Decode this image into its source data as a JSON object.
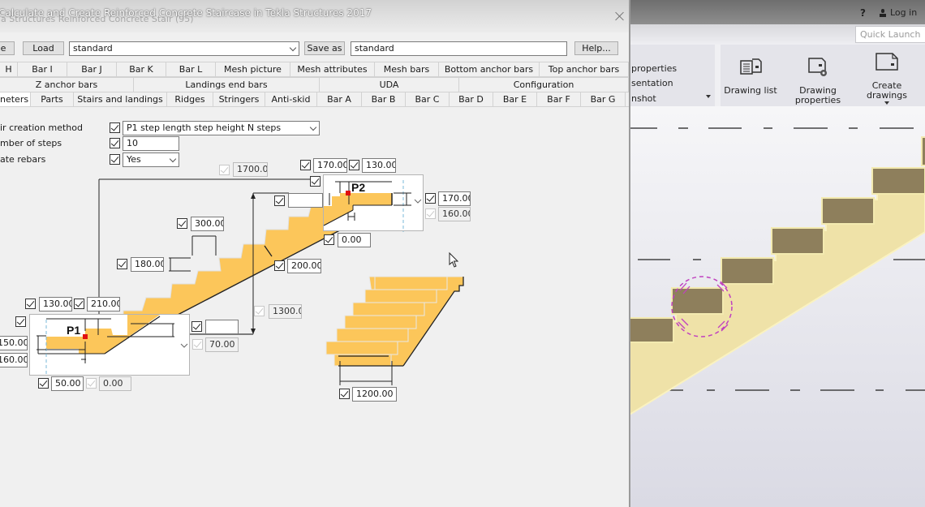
{
  "background_app": {
    "help_label": "?",
    "login_label": "Log in",
    "quick_launch_placeholder": "Quick Launch",
    "ribbon_left_items": [
      "properties",
      "sentation",
      "nshot"
    ],
    "ribbon_buttons": [
      {
        "label": "Drawing list",
        "icon": "drawing-list-icon"
      },
      {
        "label": "Drawing properties",
        "icon": "drawing-properties-icon"
      },
      {
        "label": "Create drawings",
        "icon": "create-drawings-icon"
      }
    ]
  },
  "dialog": {
    "title": "Calculate and Create Reinforced Concrete Staircase in Tekla Structures 2017",
    "title_ghost": "la Structures  Reinforced Concrete Stair (95)",
    "toolbar": {
      "save_label": "e",
      "load_label": "Load",
      "preset_value": "standard",
      "save_as_label": "Save as",
      "save_as_value": "standard",
      "help_label": "Help..."
    },
    "tab_rows": [
      [
        "H",
        "Bar I",
        "Bar J",
        "Bar K",
        "Bar L",
        "Mesh picture",
        "Mesh attributes",
        "Mesh bars",
        "Bottom anchor bars",
        "Top anchor bars"
      ],
      [
        "Z anchor bars",
        "Landings end bars",
        "UDA",
        "Configuration"
      ],
      [
        "neters",
        "Parts",
        "Stairs and landings",
        "Ridges",
        "Stringers",
        "Anti-skid",
        "Bar A",
        "Bar B",
        "Bar C",
        "Bar D",
        "Bar E",
        "Bar F",
        "Bar G"
      ]
    ],
    "active_tab": "neters",
    "fields": {
      "creation_method": {
        "label": "ir creation method",
        "value": "P1 step length step height N steps"
      },
      "number_of_steps": {
        "label": "mber of steps",
        "value": "10"
      },
      "create_rebars": {
        "label": "ate rebars",
        "value": "Yes"
      }
    },
    "dimensions": {
      "total_length": "1700.00",
      "p2_top_left": "170.00",
      "p2_top_right": "130.00",
      "p2_side_input": "",
      "p2_right_height": "170.00",
      "p2_right_height2": "160.00",
      "p2_bottom": "0.00",
      "step_length": "300.00",
      "step_height": "180.00",
      "slab_thickness": "200.00",
      "total_height": "1300.00",
      "p1_top_left": "130.00",
      "p1_top_right": "210.00",
      "p1_left_height": "150.00",
      "p1_left_height2": "160.00",
      "p1_right_input": "",
      "p1_right_offset": "70.00",
      "p1_bottom_left": "50.00",
      "p1_bottom_right": "0.00",
      "stair_width": "1200.00"
    },
    "p1_label": "P1",
    "p2_label": "P2"
  },
  "colors": {
    "stair_fill": "#fcc65a",
    "point_marker": "#e01010",
    "model_step": "#8e7f5c",
    "model_stringer": "#efe2a8",
    "selection_circle": "#c040c0"
  }
}
